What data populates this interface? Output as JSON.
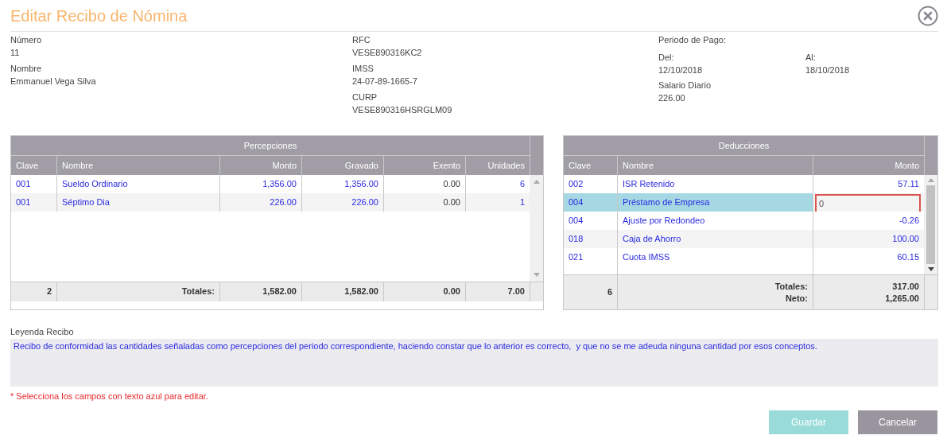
{
  "dialog": {
    "title": "Editar Recibo de Nómina"
  },
  "employee": [
    {
      "label": "Número",
      "value": "11"
    },
    {
      "label": "Nombre",
      "value": "Emmanuel Vega Silva"
    }
  ],
  "ids": [
    {
      "label": "RFC",
      "value": "VESE890316KC2"
    },
    {
      "label": "IMSS",
      "value": "24-07-89-1665-7"
    },
    {
      "label": "CURP",
      "value": "VESE890316HSRGLM09"
    }
  ],
  "period": {
    "heading": "Periodo de Pago:",
    "from": {
      "label": "Del:",
      "value": "12/10/2018"
    },
    "to": {
      "label": "Al:",
      "value": "18/10/2018"
    },
    "salary": {
      "label": "Salario Diario",
      "value": "226.00"
    }
  },
  "percepciones": {
    "title": "Percepciones",
    "columns": [
      {
        "label": "Clave",
        "editable": true
      },
      {
        "label": "Nombre",
        "editable": true
      },
      {
        "label": "Monto",
        "editable": true
      },
      {
        "label": "Gravado",
        "editable": true
      },
      {
        "label": "Exento",
        "editable": false
      },
      {
        "label": "Unidades",
        "editable": true
      }
    ],
    "rows": [
      {
        "selected": false,
        "cells": [
          "001",
          "Sueldo Ordinario",
          "1,356.00",
          "1,356.00",
          "0.00",
          "6"
        ]
      },
      {
        "selected": false,
        "cells": [
          "001",
          "Séptimo Dia",
          "226.00",
          "226.00",
          "0.00",
          "1"
        ]
      }
    ],
    "totals": {
      "count": "2",
      "labels": [
        "Totales:"
      ],
      "values": [
        [
          "1,582.00"
        ],
        [
          "1,582.00"
        ],
        [
          "0.00"
        ],
        [
          "7.00"
        ]
      ]
    }
  },
  "deducciones": {
    "title": "Deducciones",
    "columns": [
      {
        "label": "Clave",
        "editable": true
      },
      {
        "label": "Nombre",
        "editable": true
      },
      {
        "label": "Monto",
        "editable": true
      }
    ],
    "rows": [
      {
        "selected": false,
        "cells": [
          "002",
          "ISR Retenido",
          "57.11"
        ]
      },
      {
        "selected": true,
        "cells": [
          "004",
          "Préstamo de Empresa",
          "0"
        ]
      },
      {
        "selected": false,
        "cells": [
          "004",
          "Ajuste por Redondeo",
          "-0.26"
        ]
      },
      {
        "selected": false,
        "cells": [
          "018",
          "Caja de Ahorro",
          "100.00"
        ]
      },
      {
        "selected": false,
        "cells": [
          "021",
          "Cuota IMSS",
          "60.15"
        ]
      }
    ],
    "totals": {
      "count": "6",
      "labels": [
        "Totales:",
        "Neto:"
      ],
      "values": [
        [
          "317.00",
          "1,265.00"
        ]
      ]
    }
  },
  "legend": {
    "label": "Leyenda Recibo",
    "value": "Recibo de conformidad las cantidades señaladas como percepciones del periodo correspondiente, haciendo constar que lo anterior es correcto,  y que no se me adeuda ninguna cantidad por esos conceptos."
  },
  "note": "* Selecciona los campos con texto azul para editar.",
  "buttons": [
    {
      "label": "Guardar",
      "kind": "primary",
      "disabled": true
    },
    {
      "label": "Cancelar",
      "kind": "secondary",
      "disabled": false
    }
  ]
}
